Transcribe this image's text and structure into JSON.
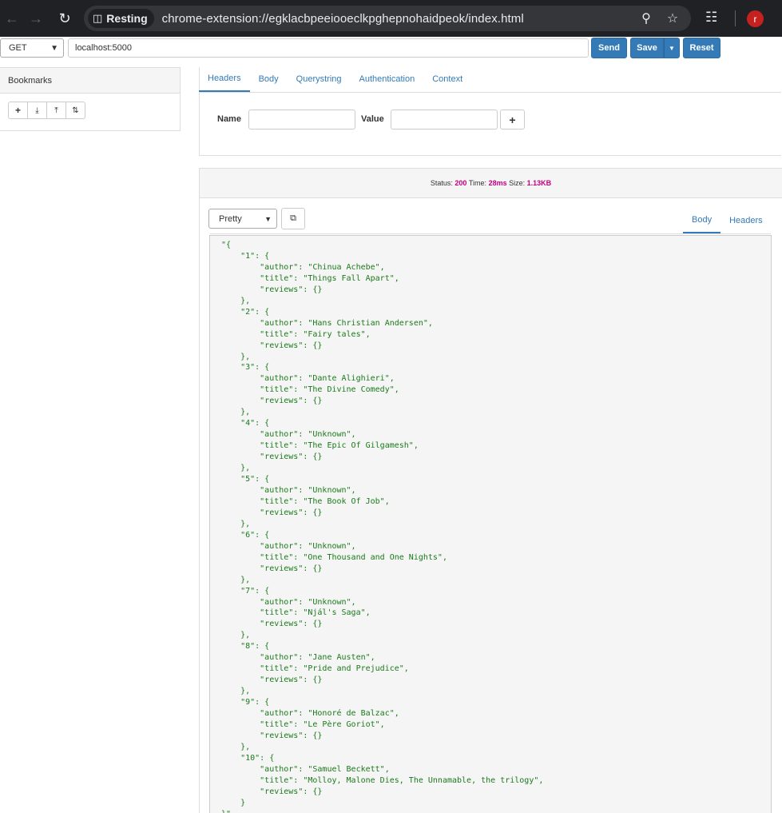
{
  "browser": {
    "site_chip_label": "Resting",
    "url": "chrome-extension://egklacbpeeiooeclkpghepnohaidpeok/index.html",
    "avatar_letter": "r",
    "icons": [
      "back-arrow-icon",
      "forward-arrow-icon",
      "reload-icon",
      "extension-icon",
      "zoom-icon",
      "star-icon",
      "puzzle-icon"
    ]
  },
  "request": {
    "method": "GET",
    "url": "localhost:5000",
    "send_label": "Send",
    "save_label": "Save",
    "reset_label": "Reset"
  },
  "bookmarks": {
    "title": "Bookmarks",
    "toolbar_icons": [
      "add-icon",
      "import-icon",
      "export-icon",
      "sort-icon"
    ]
  },
  "request_tabs": [
    {
      "label": "Headers",
      "active": true
    },
    {
      "label": "Body",
      "active": false
    },
    {
      "label": "Querystring",
      "active": false
    },
    {
      "label": "Authentication",
      "active": false
    },
    {
      "label": "Context",
      "active": false
    }
  ],
  "header_form": {
    "name_label": "Name",
    "value_label": "Value",
    "name_value": "",
    "value_value": ""
  },
  "response": {
    "status_label": "Status:",
    "status_value": "200",
    "time_label": "Time:",
    "time_value": "28ms",
    "size_label": "Size:",
    "size_value": "1.13KB",
    "format": "Pretty",
    "tabs": [
      {
        "label": "Body",
        "active": true
      },
      {
        "label": "Headers",
        "active": false
      }
    ],
    "body": "\"{\n    \"1\": {\n        \"author\": \"Chinua Achebe\",\n        \"title\": \"Things Fall Apart\",\n        \"reviews\": {}\n    },\n    \"2\": {\n        \"author\": \"Hans Christian Andersen\",\n        \"title\": \"Fairy tales\",\n        \"reviews\": {}\n    },\n    \"3\": {\n        \"author\": \"Dante Alighieri\",\n        \"title\": \"The Divine Comedy\",\n        \"reviews\": {}\n    },\n    \"4\": {\n        \"author\": \"Unknown\",\n        \"title\": \"The Epic Of Gilgamesh\",\n        \"reviews\": {}\n    },\n    \"5\": {\n        \"author\": \"Unknown\",\n        \"title\": \"The Book Of Job\",\n        \"reviews\": {}\n    },\n    \"6\": {\n        \"author\": \"Unknown\",\n        \"title\": \"One Thousand and One Nights\",\n        \"reviews\": {}\n    },\n    \"7\": {\n        \"author\": \"Unknown\",\n        \"title\": \"Njál's Saga\",\n        \"reviews\": {}\n    },\n    \"8\": {\n        \"author\": \"Jane Austen\",\n        \"title\": \"Pride and Prejudice\",\n        \"reviews\": {}\n    },\n    \"9\": {\n        \"author\": \"Honoré de Balzac\",\n        \"title\": \"Le Père Goriot\",\n        \"reviews\": {}\n    },\n    \"10\": {\n        \"author\": \"Samuel Beckett\",\n        \"title\": \"Molloy, Malone Dies, The Unnamable, the trilogy\",\n        \"reviews\": {}\n    }\n}\""
  },
  "colors": {
    "primary": "#337ab7",
    "status_highlight": "#c7007f",
    "code_text": "#1a7a1a",
    "browser_frame": "#202124"
  }
}
